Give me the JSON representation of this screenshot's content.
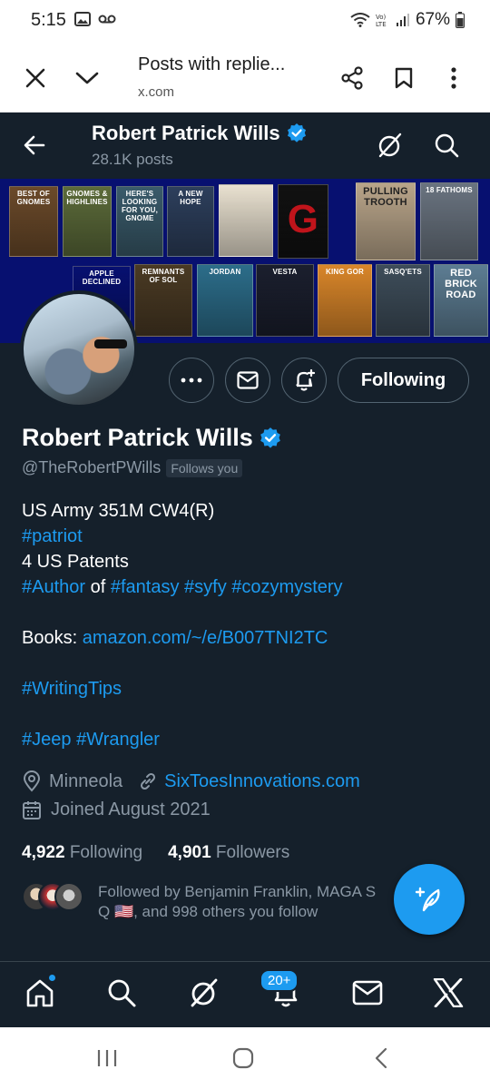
{
  "status_bar": {
    "time": "5:15",
    "battery": "67%"
  },
  "browser": {
    "title": "Posts with replie...",
    "url": "x.com"
  },
  "header": {
    "name": "Robert Patrick Wills",
    "posts": "28.1K posts"
  },
  "banner_books": [
    {
      "title": "BEST OF GNOMES",
      "color": "#6b4a2a"
    },
    {
      "title": "GNOMES & HIGHLINES",
      "color": "#5c6b3a"
    },
    {
      "title": "HERE'S LOOKING FOR YOU, GNOME",
      "color": "#3a5b6b"
    },
    {
      "title": "A NEW HOPE",
      "color": "#2d3f5c"
    },
    {
      "title": "",
      "color": "#e9e1d0"
    },
    {
      "title": "G",
      "color": "#111111"
    },
    {
      "title": "PULLING TROOTH",
      "color": "#b9a58a"
    },
    {
      "title": "18 FATHOMS",
      "color": "#6a7480"
    },
    {
      "title": "APPLE DECLINED",
      "color": "#071070"
    },
    {
      "title": "REMNANTS OF SOL",
      "color": "#4a3a24"
    },
    {
      "title": "JORDAN",
      "color": "#2c6d8a"
    },
    {
      "title": "VESTA",
      "color": "#1b1f2e"
    },
    {
      "title": "KING GOR",
      "color": "#d9862a"
    },
    {
      "title": "SASQ'ETS",
      "color": "#3e4d5a"
    },
    {
      "title": "RED BRICK ROAD",
      "color": "#5d7d93"
    }
  ],
  "actions": {
    "following_label": "Following"
  },
  "profile": {
    "name": "Robert Patrick Wills",
    "handle": "@TheRobertPWills",
    "follows_you": "Follows you",
    "bio": {
      "line1": "US Army 351M CW4(R)",
      "line2": "#patriot",
      "line3": "4 US Patents",
      "line4_author": "#Author",
      "line4_of": " of ",
      "line4_fantasy": "#fantasy",
      "line4_syfy": "#syfy",
      "line4_cozy": "#cozymystery",
      "books_label": "Books: ",
      "books_link": "amazon.com/~/e/B007TNI2TC",
      "writing_tips": "#WritingTips",
      "jeep": "#Jeep",
      "wrangler": "#Wrangler"
    },
    "location": "Minneola",
    "website": "SixToesInnovations.com",
    "joined": "Joined August 2021",
    "following_count": "4,922",
    "following_label": "Following",
    "followers_count": "4,901",
    "followers_label": "Followers",
    "followed_by_line1": "Followed by Benjamin Franklin, MAGA S",
    "followed_by_line2": "Q 🇺🇸, and 998 others you follow"
  },
  "bottom_nav": {
    "notifications_badge": "20+"
  },
  "colors": {
    "background": "#15202b",
    "accent": "#1d9bf0",
    "muted": "#8b98a5"
  }
}
